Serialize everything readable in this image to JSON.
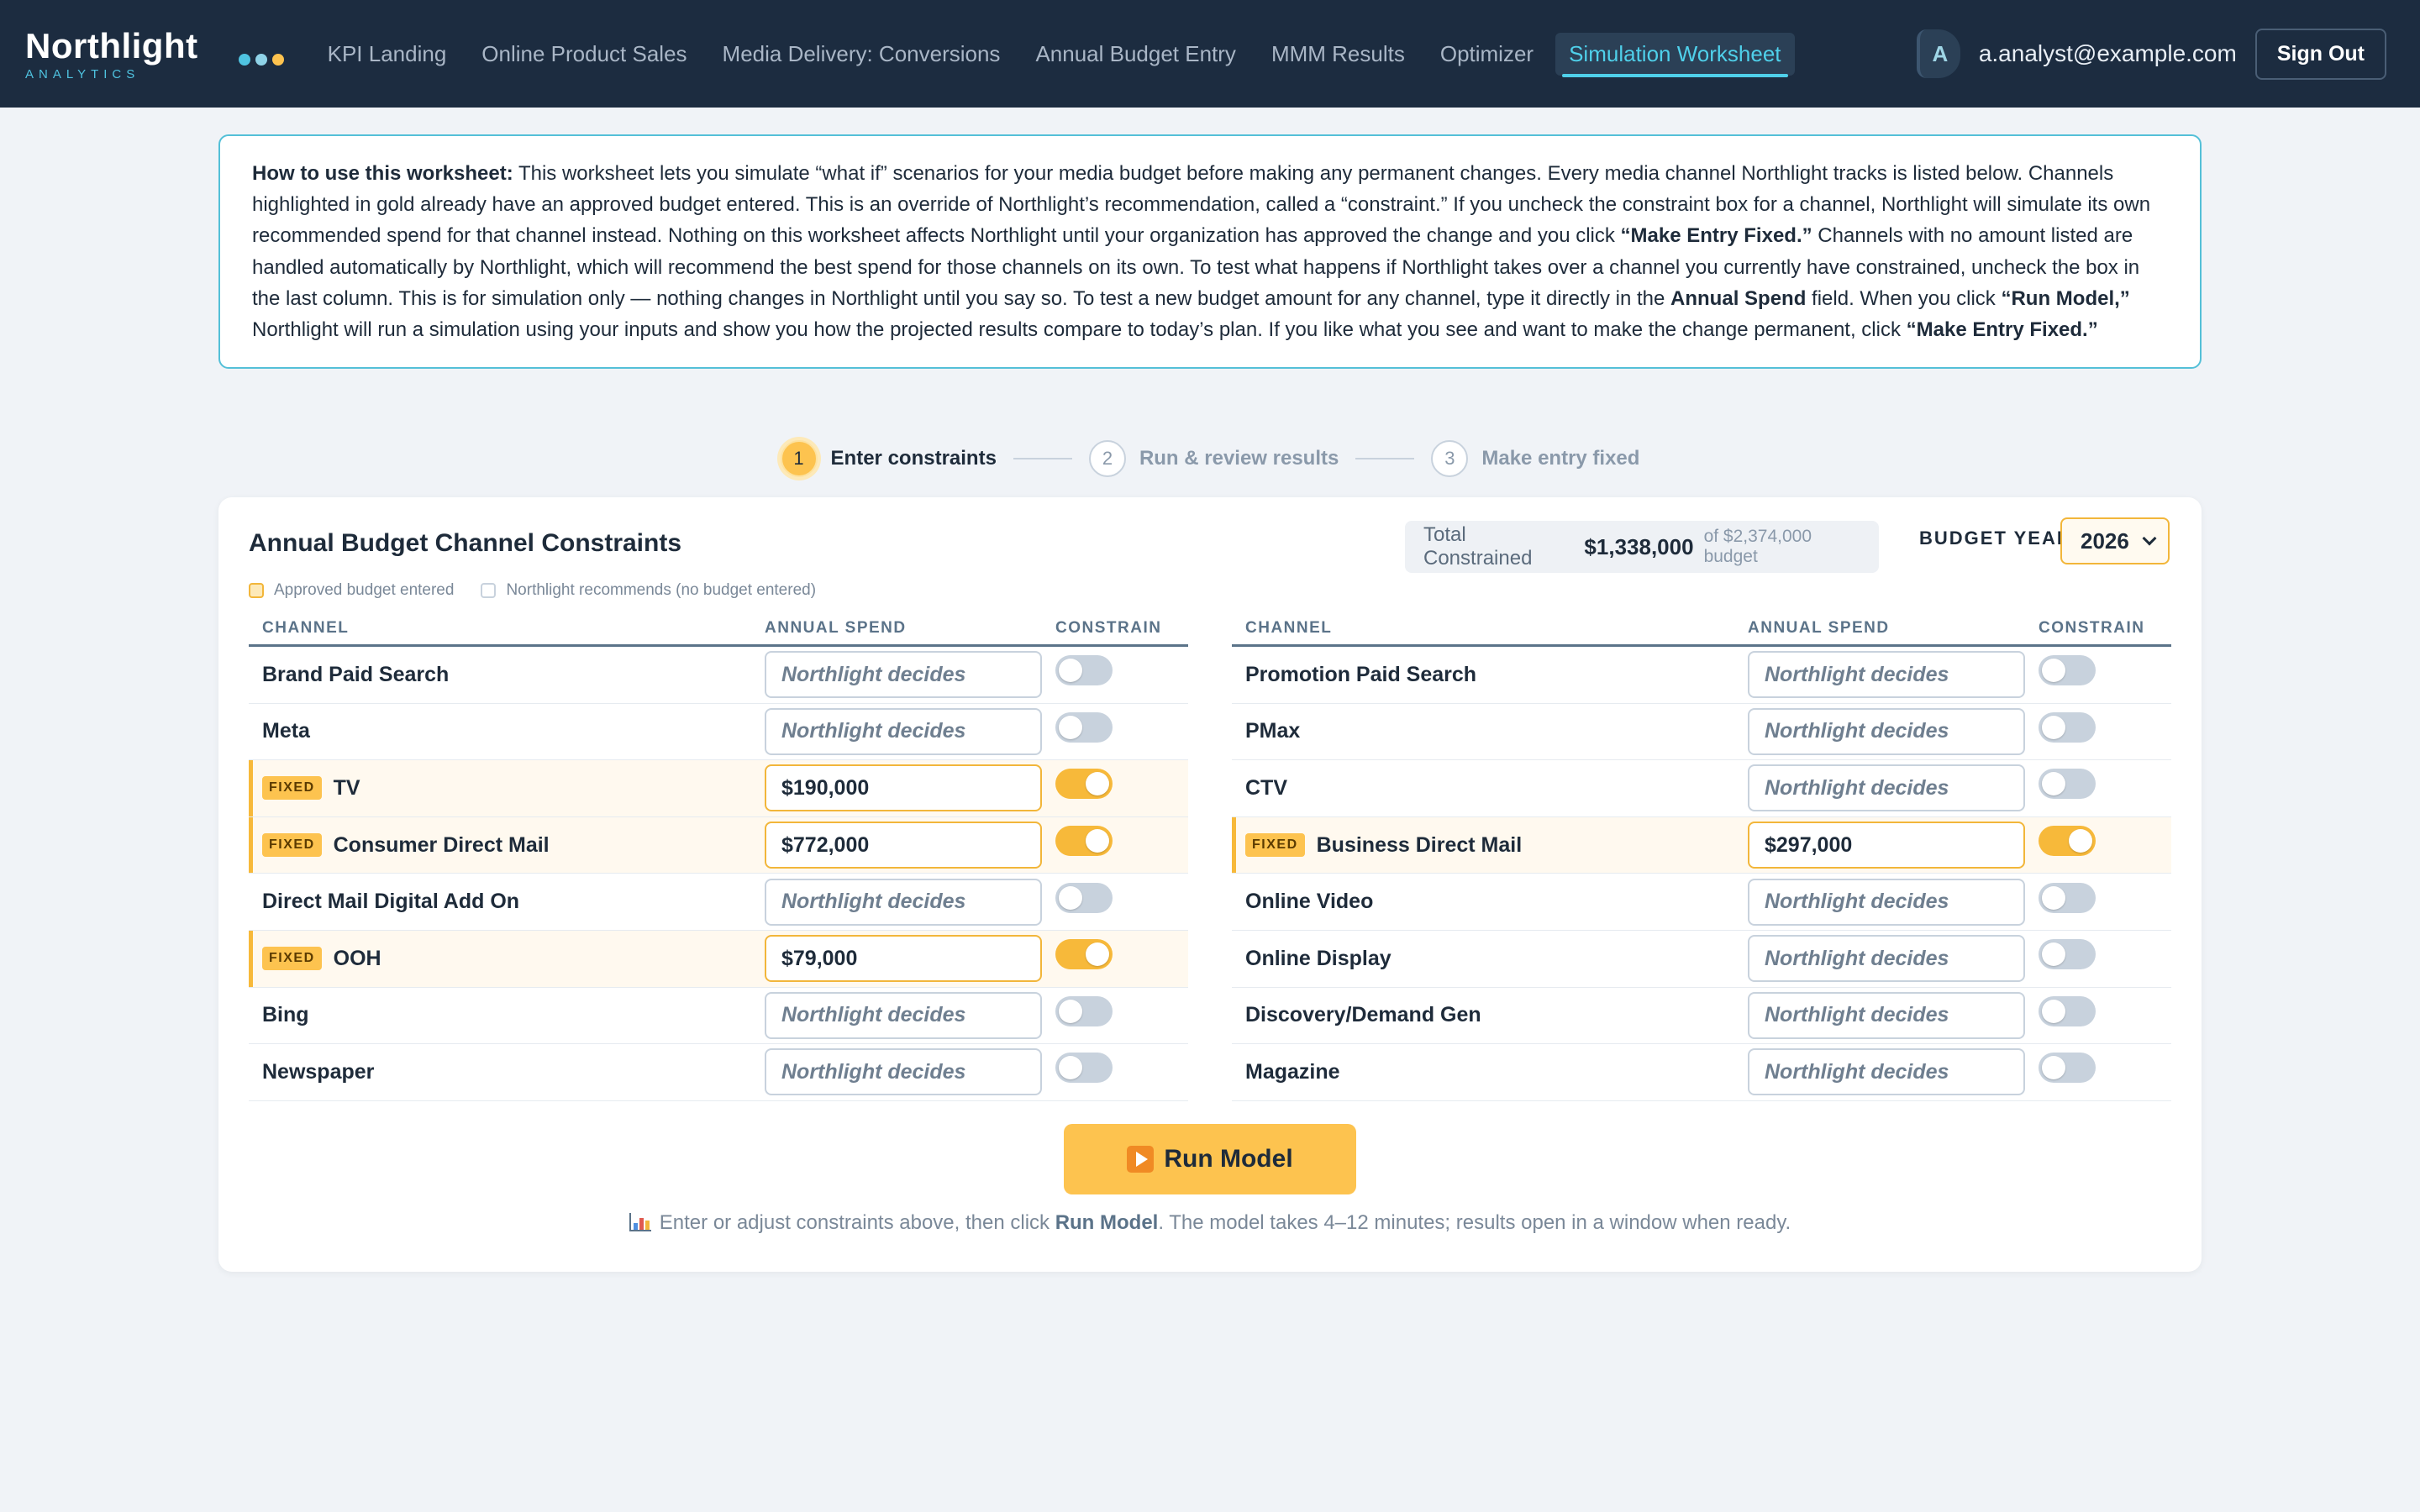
{
  "brand": {
    "name": "Northlight",
    "sub": "ANALYTICS",
    "dot_colors": [
      "#4fc3e0",
      "#8fd3e8",
      "#fdc34f"
    ]
  },
  "nav": {
    "items": [
      {
        "label": "KPI Landing",
        "active": false
      },
      {
        "label": "Online Product Sales",
        "active": false
      },
      {
        "label": "Media Delivery: Conversions",
        "active": false
      },
      {
        "label": "Annual Budget Entry",
        "active": false
      },
      {
        "label": "MMM Results",
        "active": false
      },
      {
        "label": "Optimizer",
        "active": false
      },
      {
        "label": "Simulation Worksheet",
        "active": true
      }
    ],
    "avatar_initial": "A",
    "user_email": "a.analyst@example.com",
    "signout_label": "Sign Out"
  },
  "help": {
    "lead": "How to use this worksheet:",
    "text1": " This worksheet lets you simulate “what if” scenarios for your media budget before making any permanent changes. Every media channel Northlight tracks is listed below. Channels highlighted in gold already have an approved budget entered. This is an override of Northlight’s recommendation, called a “constraint.” If you uncheck the constraint box for a channel, Northlight will simulate its own recommended spend for that channel instead. Nothing on this worksheet affects Northlight until your organization has approved the change and you click ",
    "bold1": "“Make Entry Fixed.”",
    "text2": " Channels with no amount listed are handled automatically by Northlight, which will recommend the best spend for those channels on its own. To test what happens if Northlight takes over a channel you currently have constrained, uncheck the box in the last column. This is for simulation only — nothing changes in Northlight until you say so. To test a new budget amount for any channel, type it directly in the ",
    "bold2": "Annual Spend",
    "text3": " field. When you click ",
    "bold3": "“Run Model,”",
    "text4": " Northlight will run a simulation using your inputs and show you how the projected results compare to today’s plan. If you like what you see and want to make the change permanent, click ",
    "bold4": "“Make Entry Fixed.”"
  },
  "stepper": [
    {
      "num": "1",
      "label": "Enter constraints",
      "active": true
    },
    {
      "num": "2",
      "label": "Run & review results",
      "active": false
    },
    {
      "num": "3",
      "label": "Make entry fixed",
      "active": false
    }
  ],
  "card": {
    "title": "Annual Budget Channel Constraints",
    "total_label": "Total Constrained",
    "total_value": "$1,338,000",
    "total_of": "of $2,374,000 budget",
    "year_label": "BUDGET YEAR",
    "year_value": "2026",
    "legend": [
      {
        "label": "Approved budget entered",
        "color": "#fde9b8",
        "border": "#f2b63a"
      },
      {
        "label": "Northlight recommends (no budget entered)",
        "color": "#ffffff",
        "border": "#c8d2dd"
      }
    ],
    "columns": {
      "channel": "CHANNEL",
      "spend": "ANNUAL SPEND",
      "constrain": "CONSTRAIN"
    },
    "fixed_badge": "FIXED",
    "placeholder": "Northlight decides",
    "left_rows": [
      {
        "channel": "Brand Paid Search",
        "spend": "",
        "fixed": false
      },
      {
        "channel": "Meta",
        "spend": "",
        "fixed": false
      },
      {
        "channel": "TV",
        "spend": "$190,000",
        "fixed": true
      },
      {
        "channel": "Consumer Direct Mail",
        "spend": "$772,000",
        "fixed": true
      },
      {
        "channel": "Direct Mail Digital Add On",
        "spend": "",
        "fixed": false
      },
      {
        "channel": "OOH",
        "spend": "$79,000",
        "fixed": true
      },
      {
        "channel": "Bing",
        "spend": "",
        "fixed": false
      },
      {
        "channel": "Newspaper",
        "spend": "",
        "fixed": false
      }
    ],
    "right_rows": [
      {
        "channel": "Promotion Paid Search",
        "spend": "",
        "fixed": false
      },
      {
        "channel": "PMax",
        "spend": "",
        "fixed": false
      },
      {
        "channel": "CTV",
        "spend": "",
        "fixed": false
      },
      {
        "channel": "Business Direct Mail",
        "spend": "$297,000",
        "fixed": true
      },
      {
        "channel": "Online Video",
        "spend": "",
        "fixed": false
      },
      {
        "channel": "Online Display",
        "spend": "",
        "fixed": false
      },
      {
        "channel": "Discovery/Demand Gen",
        "spend": "",
        "fixed": false
      },
      {
        "channel": "Magazine",
        "spend": "",
        "fixed": false
      }
    ],
    "run_label": "Run Model",
    "hint_pre": "Enter or adjust constraints above, then click ",
    "hint_bold": "Run Model",
    "hint_post": ". The model takes 4–12 minutes; results open in a window when ready."
  }
}
